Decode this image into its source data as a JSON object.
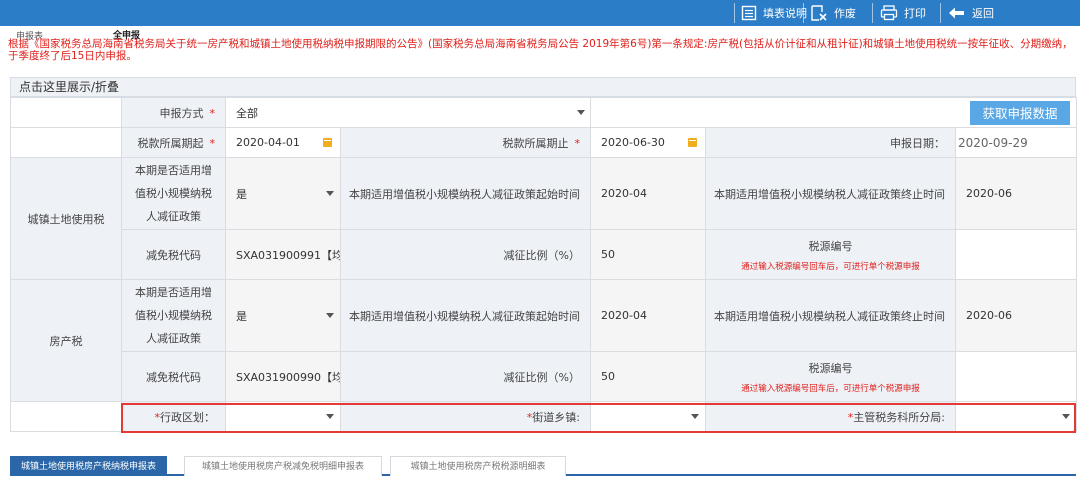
{
  "toolbar": {
    "fill_guide": "填表说明",
    "void": "作废",
    "print": "打印",
    "back": "返回"
  },
  "header": {
    "tab_left": "申报表",
    "tab_right": "全申报"
  },
  "notice": "根据《国家税务总局海南省税务局关于统一房产税和城镇土地使用税纳税申报期限的公告》(国家税务总局海南省税务局公告 2019年第6号)第一条规定:房产税(包括从价计征和从租计征)和城镇土地使用税统一按年征收、分期缴纳，于季度终了后15日内申报。",
  "toggle_label": "点击这里展示/折叠",
  "form": {
    "declare_mode_label": "申报方式",
    "declare_mode_value": "全部",
    "fetch_button": "获取申报数据",
    "period_start_label": "税款所属期起",
    "period_start_value": "2020-04-01",
    "period_end_label": "税款所属期止",
    "period_end_value": "2020-06-30",
    "declare_date_label": "申报日期：",
    "declare_date_value": "2020-09-29",
    "required_mark": "*",
    "land_tax": {
      "section": "城镇土地使用税",
      "small_scale_line1": "本期是否适用增",
      "small_scale_line2": "值税小规模纳税",
      "small_scale_line3": "人减征政策",
      "small_scale_value": "是",
      "policy_start_label": "本期适用增值税小规模纳税人减征政策起始时间",
      "policy_start_value": "2020-04",
      "policy_end_label": "本期适用增值税小规模纳税人减征政策终止时间",
      "policy_end_value": "2020-06",
      "relief_code_label": "减免税代码",
      "relief_code_value": "SXA031900991【均",
      "relief_ratio_label": "减征比例（%）",
      "relief_ratio_value": "50",
      "source_no_label": "税源编号",
      "source_no_hint": "通过输入税源编号回车后，可进行单个税源申报"
    },
    "property_tax": {
      "section": "房产税",
      "small_scale_line1": "本期是否适用增",
      "small_scale_line2": "值税小规模纳税",
      "small_scale_line3": "人减征政策",
      "small_scale_value": "是",
      "policy_start_label": "本期适用增值税小规模纳税人减征政策起始时间",
      "policy_start_value": "2020-04",
      "policy_end_label": "本期适用增值税小规模纳税人减征政策终止时间",
      "policy_end_value": "2020-06",
      "relief_code_label": "减免税代码",
      "relief_code_value": "SXA031900990【均",
      "relief_ratio_label": "减征比例（%）",
      "relief_ratio_value": "50",
      "source_no_label": "税源编号",
      "source_no_hint": "通过输入税源编号回车后，可进行单个税源申报"
    },
    "admin_region_label": "行政区划：",
    "street_label": "街道乡镇:",
    "tax_office_label": "主管税务科所分局:"
  },
  "tabs": [
    "城镇土地使用税房产税纳税申报表",
    "城镇土地使用税房产税减免税明细申报表",
    "城镇土地使用税房产税税源明细表"
  ],
  "colors": {
    "toolbar": "#2b7dc8",
    "alert_red": "#e0201b",
    "fetch_button": "#5aa7e6",
    "active_tab": "#2b67a8",
    "calendar_icon": "#f0ad1e"
  }
}
